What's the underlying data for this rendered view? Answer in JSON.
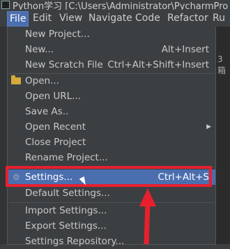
{
  "window": {
    "title": "Python学习 [C:\\Users\\Administrator\\PycharmPro"
  },
  "menubar": {
    "items": [
      {
        "label": "File"
      },
      {
        "label": "Edit"
      },
      {
        "label": "View"
      },
      {
        "label": "Navigate"
      },
      {
        "label": "Code"
      },
      {
        "label": "Refactor"
      },
      {
        "label": "Ru"
      }
    ]
  },
  "side_text": "3箱",
  "file_menu": {
    "items": [
      {
        "label": "New Project...",
        "shortcut": ""
      },
      {
        "label": "New...",
        "shortcut": "Alt+Insert"
      },
      {
        "label": "New Scratch File",
        "shortcut": "Ctrl+Alt+Shift+Insert"
      },
      {
        "label": "Open...",
        "shortcut": ""
      },
      {
        "label": "Open URL...",
        "shortcut": ""
      },
      {
        "label": "Save As..",
        "shortcut": ""
      },
      {
        "label": "Open Recent",
        "shortcut": ""
      },
      {
        "label": "Close Project",
        "shortcut": ""
      },
      {
        "label": "Rename Project...",
        "shortcut": ""
      },
      {
        "label": "Settings...",
        "shortcut": "Ctrl+Alt+S"
      },
      {
        "label": "Default Settings...",
        "shortcut": ""
      },
      {
        "label": "Import Settings...",
        "shortcut": ""
      },
      {
        "label": "Export Settings...",
        "shortcut": ""
      },
      {
        "label": "Settings Repository...",
        "shortcut": ""
      }
    ]
  },
  "icons": {
    "open": "folder-icon",
    "settings": "gear-icon",
    "open_recent": "chevron-right-icon"
  },
  "colors": {
    "highlight": "#4b6eaf",
    "annotation": "#e8202e"
  }
}
